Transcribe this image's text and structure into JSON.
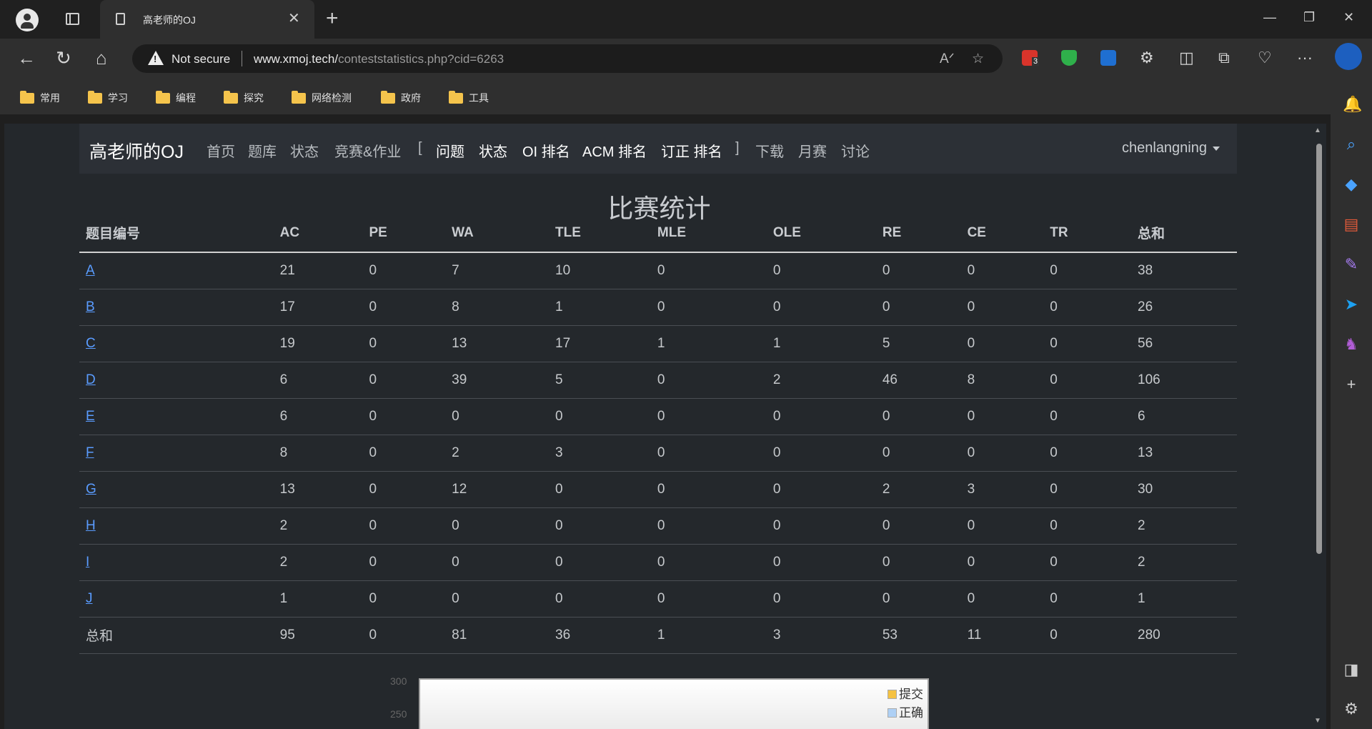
{
  "browser": {
    "tab_title": "高老师的OJ",
    "not_secure_label": "Not secure",
    "url_host": "www.xmoj.tech/",
    "url_path": "conteststatistics.php?cid=6263",
    "extension_badge": "3"
  },
  "bookmarks": [
    "常用",
    "学习",
    "编程",
    "探究",
    "网络检测",
    "政府",
    "工具"
  ],
  "site": {
    "brand": "高老师的OJ",
    "nav": [
      "首页",
      "题库",
      "状态",
      "竞赛&作业",
      "[",
      "问题",
      "状态",
      "OI 排名",
      "ACM 排名",
      "订正 排名",
      "]",
      "下载",
      "月赛",
      "讨论"
    ],
    "user": "chenlangning"
  },
  "page": {
    "title": "比赛统计"
  },
  "table": {
    "headers": [
      "题目编号",
      "AC",
      "PE",
      "WA",
      "TLE",
      "MLE",
      "OLE",
      "RE",
      "CE",
      "TR",
      "总和"
    ],
    "rows": [
      [
        "A",
        "21",
        "0",
        "7",
        "10",
        "0",
        "0",
        "0",
        "0",
        "0",
        "38"
      ],
      [
        "B",
        "17",
        "0",
        "8",
        "1",
        "0",
        "0",
        "0",
        "0",
        "0",
        "26"
      ],
      [
        "C",
        "19",
        "0",
        "13",
        "17",
        "1",
        "1",
        "5",
        "0",
        "0",
        "56"
      ],
      [
        "D",
        "6",
        "0",
        "39",
        "5",
        "0",
        "2",
        "46",
        "8",
        "0",
        "106"
      ],
      [
        "E",
        "6",
        "0",
        "0",
        "0",
        "0",
        "0",
        "0",
        "0",
        "0",
        "6"
      ],
      [
        "F",
        "8",
        "0",
        "2",
        "3",
        "0",
        "0",
        "0",
        "0",
        "0",
        "13"
      ],
      [
        "G",
        "13",
        "0",
        "12",
        "0",
        "0",
        "0",
        "2",
        "3",
        "0",
        "30"
      ],
      [
        "H",
        "2",
        "0",
        "0",
        "0",
        "0",
        "0",
        "0",
        "0",
        "0",
        "2"
      ],
      [
        "I",
        "2",
        "0",
        "0",
        "0",
        "0",
        "0",
        "0",
        "0",
        "0",
        "2"
      ],
      [
        "J",
        "1",
        "0",
        "0",
        "0",
        "0",
        "0",
        "0",
        "0",
        "0",
        "1"
      ]
    ],
    "total_row": [
      "总和",
      "95",
      "0",
      "81",
      "36",
      "1",
      "3",
      "53",
      "11",
      "0",
      "280"
    ]
  },
  "chart": {
    "y_ticks": [
      "300",
      "250"
    ],
    "legend": [
      "提交",
      "正确"
    ],
    "colors": {
      "submit": "#f5c242",
      "correct": "#aed0f5"
    }
  },
  "colors": {
    "page_bg": "#24282c",
    "navbar_bg": "#2c3036",
    "link": "#5a9cff"
  }
}
